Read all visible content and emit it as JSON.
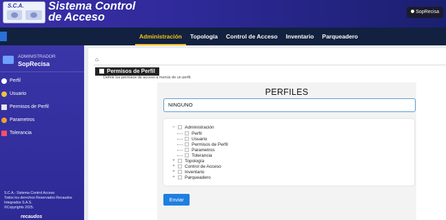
{
  "header": {
    "logo_text": "S.C.A.",
    "brand_line1": "Sistema Control",
    "brand_line2": "de Acceso",
    "user_button": "SopRecisa"
  },
  "nav": {
    "items": [
      "Administración",
      "Topología",
      "Control de Acceso",
      "Inventario",
      "Parqueadero"
    ],
    "active": "Administración"
  },
  "sidebar": {
    "role": "ADMINISTRADOR",
    "user": "SopRecisa",
    "items": [
      {
        "label": "Perfil",
        "icon": "user-icon",
        "color": "#ffffff"
      },
      {
        "label": "Usuario",
        "icon": "users-icon",
        "color": "#f0c040"
      },
      {
        "label": "Permisos de Perfil",
        "icon": "lock-icon",
        "color": "#e8e8e8"
      },
      {
        "label": "Parametros",
        "icon": "gear-icon",
        "color": "#f0a030"
      },
      {
        "label": "Tolerancia",
        "icon": "flag-icon",
        "color": "#ff4d6a"
      }
    ],
    "footer": [
      "S.C.A.- Sistema Control Acceso",
      "Todos los derechos Reservados Recaudos",
      "Integrados S.A.S.",
      "©Copyrights 2025."
    ],
    "footer_logo": "recaudos"
  },
  "main": {
    "home_icon": "home-icon",
    "page_title": "Permisos de Perfil",
    "subtitle": "Definir los permisos de acceso a menús de un perfil.",
    "section_title": "PERFILES",
    "profile_select": "NINGUNO",
    "send_button": "Enviar"
  },
  "tree": {
    "nodes": [
      {
        "label": "Administración",
        "expanded": true,
        "checked": false,
        "children": [
          "Perfil",
          "Usuario",
          "Permisos de Perfil",
          "Parametros",
          "Tolerancia"
        ]
      },
      {
        "label": "Topología",
        "expanded": false,
        "checked": false
      },
      {
        "label": "Control de Acceso",
        "expanded": false,
        "checked": false
      },
      {
        "label": "Inventario",
        "expanded": false,
        "checked": false
      },
      {
        "label": "Parqueadero",
        "expanded": false,
        "checked": false
      }
    ]
  },
  "colors": {
    "accent": "#f5c518",
    "sidebar": "#3a35a8",
    "navbar": "#12213f",
    "button": "#1e7fe0"
  }
}
